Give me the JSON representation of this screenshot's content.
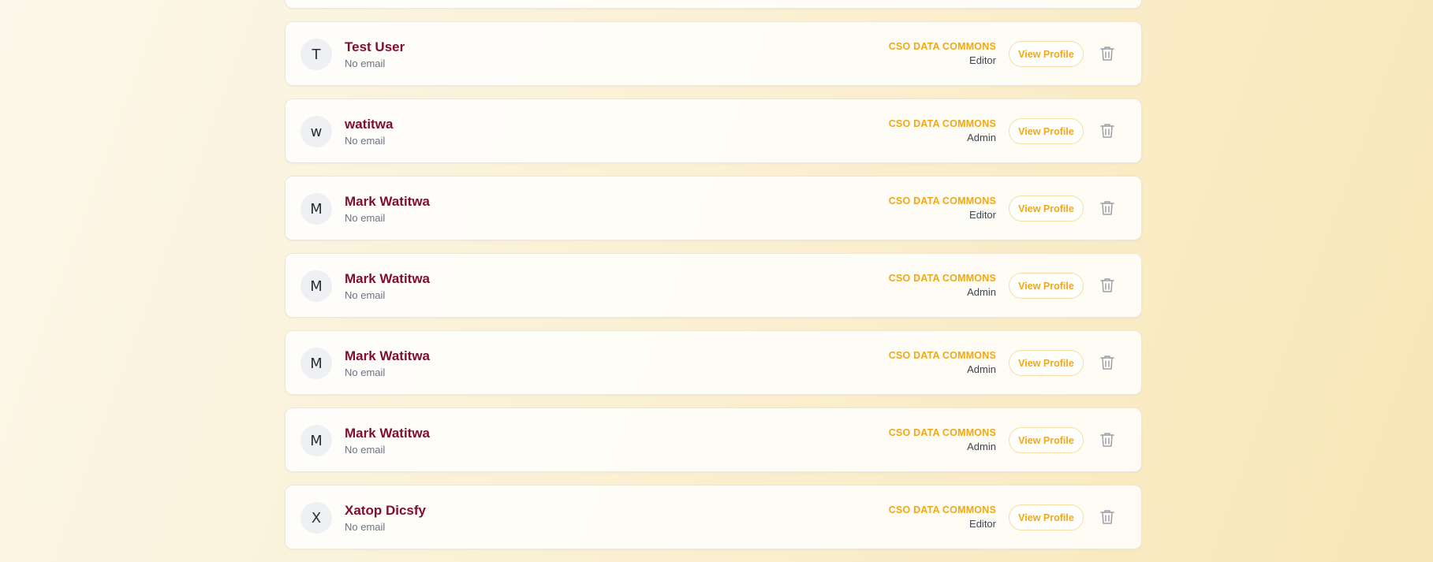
{
  "colors": {
    "name": "#7d0f33",
    "org": "#f0a818",
    "button_text": "#f0a818",
    "delete_icon": "#9aa0aa"
  },
  "users": [
    {
      "initial": "T",
      "name": "Test User",
      "email": "No email",
      "org": "CSO DATA COMMONS",
      "role": "Editor",
      "view_label": "View Profile",
      "delete_icon": "trash-icon"
    },
    {
      "initial": "w",
      "name": "watitwa",
      "email": "No email",
      "org": "CSO DATA COMMONS",
      "role": "Admin",
      "view_label": "View Profile",
      "delete_icon": "trash-icon"
    },
    {
      "initial": "M",
      "name": "Mark Watitwa",
      "email": "No email",
      "org": "CSO DATA COMMONS",
      "role": "Editor",
      "view_label": "View Profile",
      "delete_icon": "trash-icon"
    },
    {
      "initial": "M",
      "name": "Mark Watitwa",
      "email": "No email",
      "org": "CSO DATA COMMONS",
      "role": "Admin",
      "view_label": "View Profile",
      "delete_icon": "trash-icon"
    },
    {
      "initial": "M",
      "name": "Mark Watitwa",
      "email": "No email",
      "org": "CSO DATA COMMONS",
      "role": "Admin",
      "view_label": "View Profile",
      "delete_icon": "trash-icon"
    },
    {
      "initial": "M",
      "name": "Mark Watitwa",
      "email": "No email",
      "org": "CSO DATA COMMONS",
      "role": "Admin",
      "view_label": "View Profile",
      "delete_icon": "trash-icon"
    },
    {
      "initial": "X",
      "name": "Xatop Dicsfy",
      "email": "No email",
      "org": "CSO DATA COMMONS",
      "role": "Editor",
      "view_label": "View Profile",
      "delete_icon": "trash-icon"
    }
  ]
}
